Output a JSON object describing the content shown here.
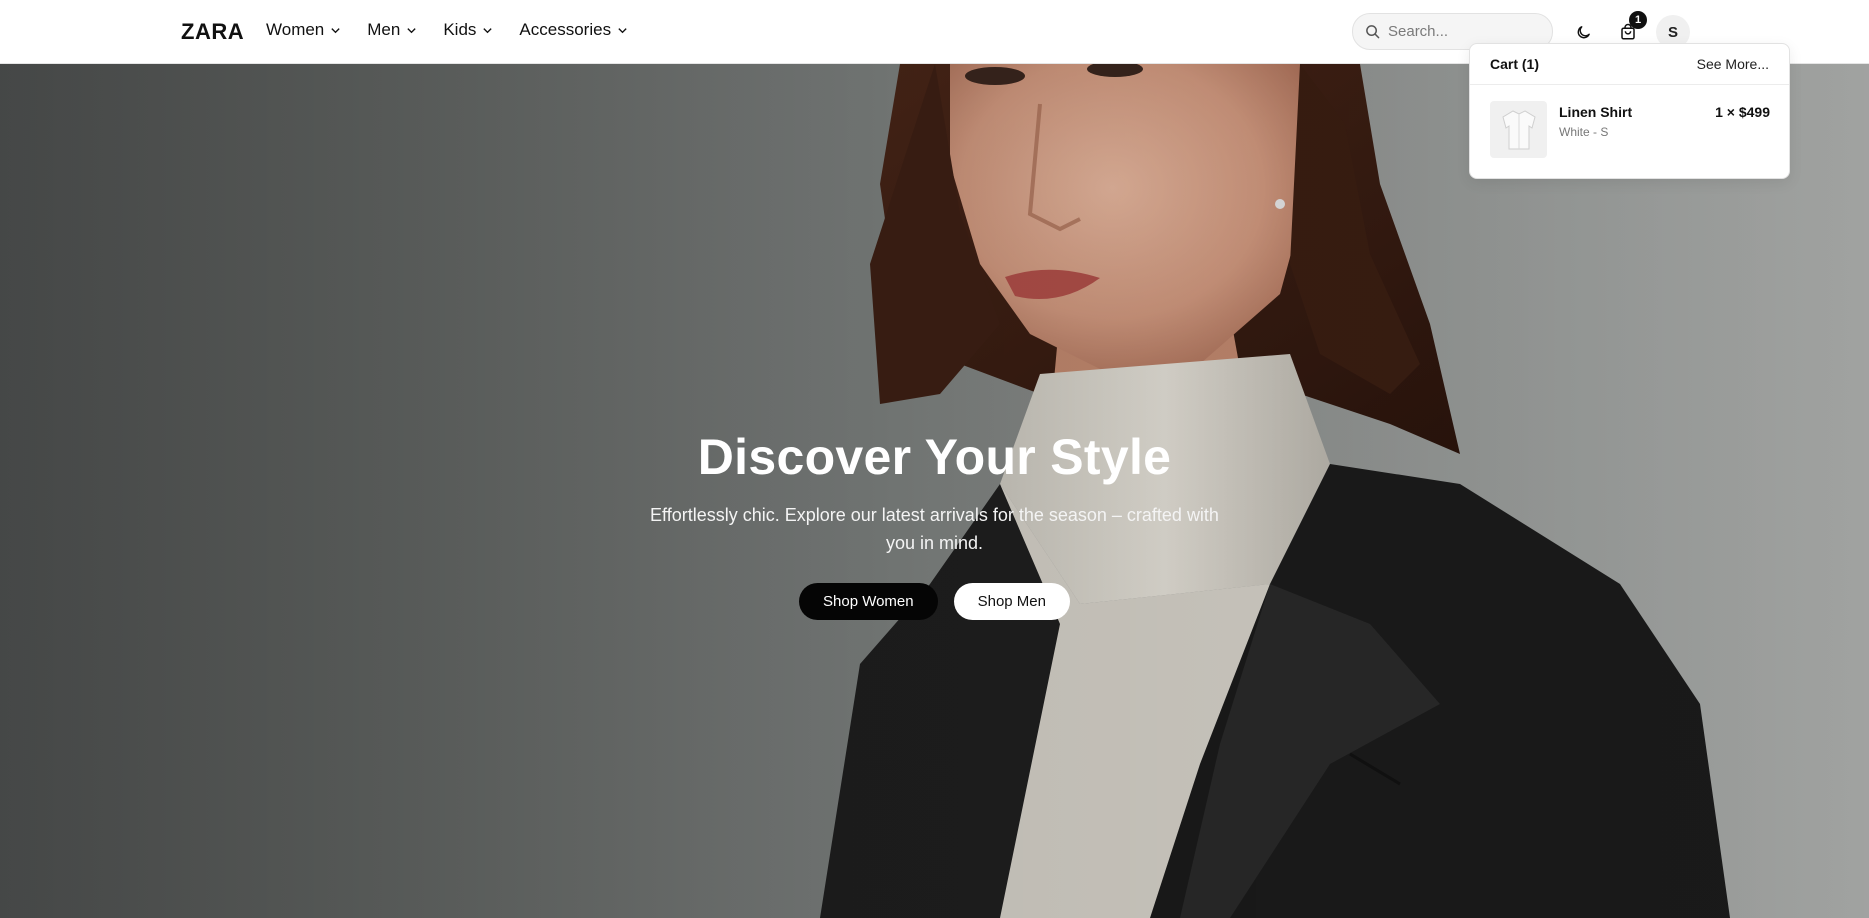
{
  "header": {
    "logo": "ZARA",
    "nav": [
      {
        "label": "Women"
      },
      {
        "label": "Men"
      },
      {
        "label": "Kids"
      },
      {
        "label": "Accessories"
      }
    ],
    "search_placeholder": "Search...",
    "cart_count": "1",
    "avatar_initial": "S"
  },
  "hero": {
    "title": "Discover Your Style",
    "subtitle": "Effortlessly chic. Explore our latest arrivals for the season – crafted with you in mind.",
    "buttons": {
      "primary": "Shop Women",
      "secondary": "Shop Men"
    }
  },
  "cart_dropdown": {
    "title": "Cart (1)",
    "see_more": "See More...",
    "items": [
      {
        "name": "Linen Shirt",
        "variant": "White - S",
        "qty_price": "1 × $499"
      }
    ]
  },
  "colors": {
    "accent": "#050505",
    "background": "#ffffff"
  }
}
